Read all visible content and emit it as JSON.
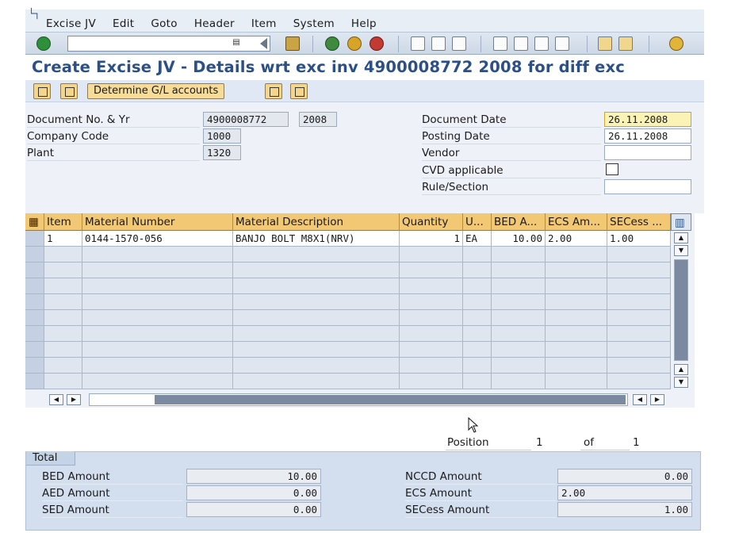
{
  "menu": {
    "items": [
      "Excise JV",
      "Edit",
      "Goto",
      "Header",
      "Item",
      "System",
      "Help"
    ]
  },
  "toolbar": {
    "icons": [
      "enter-icon",
      "save-icon",
      "back-icon",
      "exit-icon",
      "cancel-icon",
      "print-icon",
      "find-icon",
      "find-next-icon",
      "first-page-icon",
      "previous-page-icon",
      "next-page-icon",
      "last-page-icon",
      "new-session-icon",
      "shortcut-icon",
      "help-icon"
    ]
  },
  "title": "Create Excise JV - Details wrt exc inv 4900008772 2008 for diff exc",
  "app_toolbar": {
    "determine_gl_label": "Determine G/L accounts"
  },
  "header": {
    "doc_no_label": "Document No. & Yr",
    "doc_no": "4900008772",
    "doc_year": "2008",
    "company_code_label": "Company Code",
    "company_code": "1000",
    "plant_label": "Plant",
    "plant": "1320",
    "doc_date_label": "Document Date",
    "doc_date": "26.11.2008",
    "posting_date_label": "Posting Date",
    "posting_date": "26.11.2008",
    "vendor_label": "Vendor",
    "vendor": "",
    "cvd_label": "CVD applicable",
    "cvd_checked": false,
    "rule_label": "Rule/Section",
    "rule": ""
  },
  "table": {
    "columns": [
      "Item",
      "Material Number",
      "Material Description",
      "Quantity",
      "U...",
      "BED A...",
      "ECS Am...",
      "SECess ..."
    ],
    "rows": [
      {
        "item": "1",
        "material": "0144-1570-056",
        "description": "BANJO BOLT M8X1(NRV)",
        "quantity": "1",
        "unit": "EA",
        "bed": "10.00",
        "ecs": "2.00",
        "secess": "1.00"
      }
    ],
    "empty_rows": 9
  },
  "position": {
    "label": "Position",
    "current": "1",
    "of_label": "of",
    "total": "1"
  },
  "total": {
    "tab_label": "Total",
    "bed_label": "BED Amount",
    "bed": "10.00",
    "aed_label": "AED Amount",
    "aed": "0.00",
    "sed_label": "SED Amount",
    "sed": "0.00",
    "nccd_label": "NCCD Amount",
    "nccd": "0.00",
    "ecs_label": "ECS Amount",
    "ecs": "2.00",
    "secess_label": "SECess Amount",
    "secess": "1.00"
  }
}
